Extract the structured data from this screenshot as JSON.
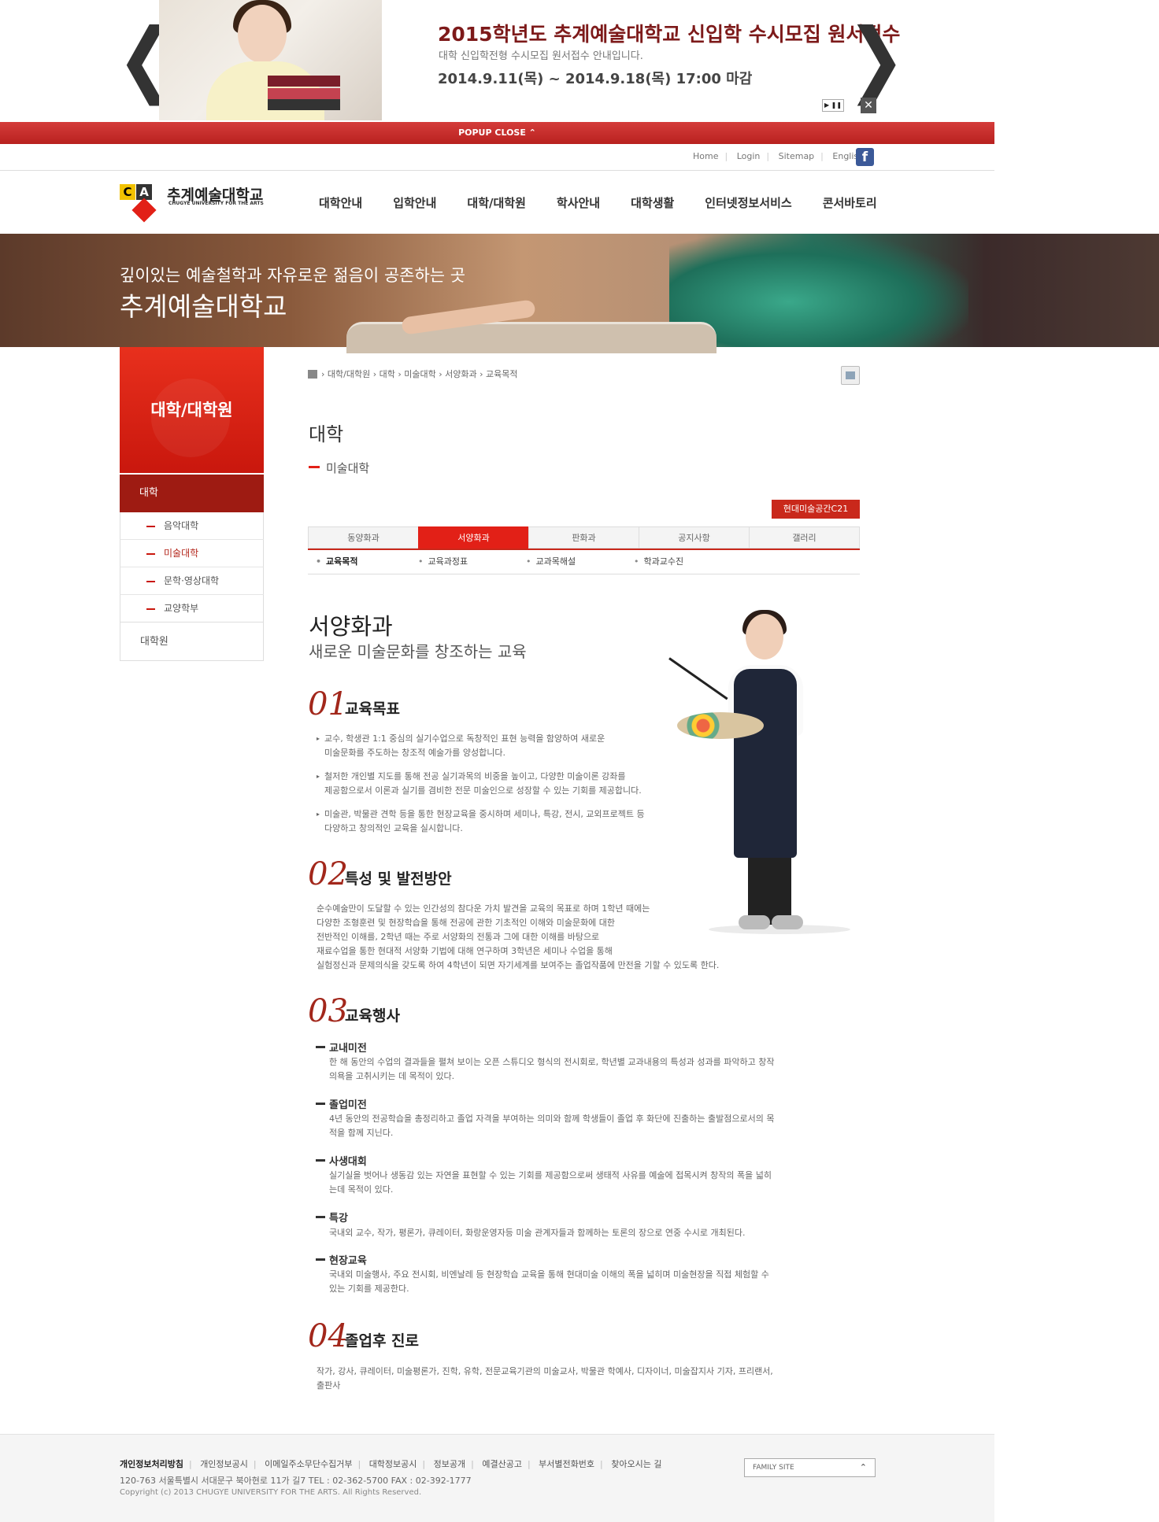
{
  "popup": {
    "title": "2015학년도 추계예술대학교 신입학 수시모집 원서접수",
    "subtitle": "대학 신입학전형 수시모집 원서접수 안내입니다.",
    "date": "2014.9.11(목) ~ 2014.9.18(목) 17:00 마감",
    "prev_arrow": "❮",
    "next_arrow": "❯",
    "play_pause": "▶ ❚❚",
    "close_x": "✕",
    "close_label": "POPUP CLOSE ⌃"
  },
  "utility": {
    "links": [
      "Home",
      "Login",
      "Sitemap",
      "English"
    ],
    "facebook": "f"
  },
  "logo": {
    "mark_c": "C",
    "mark_a": "A",
    "name": "추계예술대학교",
    "eng": "CHUGYE UNIVERSITY FOR THE ARTS"
  },
  "gnb": [
    "대학안내",
    "입학안내",
    "대학/대학원",
    "학사안내",
    "대학생활",
    "인터넷정보서비스",
    "콘서바토리"
  ],
  "banner": {
    "subtitle": "깊이있는 예술철학과 자유로운 젊음이 공존하는 곳",
    "title": "추계예술대학교"
  },
  "sidebar": {
    "header": "대학/대학원",
    "current": "대학",
    "items": [
      "음악대학",
      "미술대학",
      "문학·영상대학",
      "교양학부"
    ],
    "grad": "대학원"
  },
  "breadcrumb": "›  대학/대학원  ›  대학  ›  미술대학  ›  서양화과  ›  교육목적",
  "page": {
    "title": "대학",
    "subtitle": "미술대학",
    "ext_button": "현대미술공간C21"
  },
  "tabs": [
    "동양화과",
    "서양화과",
    "판화과",
    "공지사항",
    "갤러리"
  ],
  "active_tab": "서양화과",
  "subtabs": [
    "교육목적",
    "교육과정표",
    "교과목해설",
    "학과교수진"
  ],
  "main": {
    "heading": "서양화과",
    "heading_sub": "새로운 미술문화를 창조하는 교육",
    "s1": {
      "num": "01",
      "title": "교육목표",
      "bullets": [
        [
          "교수, 학생관 1:1 중심의 실기수업으로 독창적인 표현 능력을 함양하여 새로운",
          "미술문화를 주도하는 창조적 예술가를 양성합니다."
        ],
        [
          "철저한 개인별 지도를 통해 전공 실기과목의 비중을 높이고, 다양한 미술이론 강좌를",
          "제공함으로서 이론과 실기를 겸비한 전문 미술인으로 성장할 수 있는 기회를 제공합니다."
        ],
        [
          "미술관, 박물관 견학 등을 통한 현장교육을 중시하며 세미나, 특강, 전시, 교외프로젝트 등",
          "다양하고 창의적인 교육을 실시합니다."
        ]
      ]
    },
    "s2": {
      "num": "02",
      "title": "특성 및 발전방안",
      "lines": [
        "순수예술만이 도달할 수 있는 인간성의 참다운 가치 발견을 교육의 목표로 하며 1학년 때에는",
        "다양한 조형훈련 및 현장학습을 통해 전공에 관한 기초적인 이해와 미술문화에 대한",
        "전반적인 이해를, 2학년 때는 주로 서양화의 전통과 그에 대한 이해를 바탕으로",
        "재료수업을 통한 현대적 서양화 기법에 대해 연구하며 3학년은 세미나 수업을 통해",
        "실험정신과 문제의식을 갖도록 하여 4학년이 되면 자기세계를 보여주는 졸업작품에 만전을 기할 수 있도록 한다."
      ]
    },
    "s3": {
      "num": "03",
      "title": "교육행사",
      "events": [
        {
          "title": "교내미전",
          "lines": [
            "한 해 동안의 수업의 결과들을 펼쳐 보이는 오픈 스튜디오 형식의 전시회로, 학년별 교과내용의 특성과 성과를 파악하고 창작",
            "의욕을 고취시키는 데 목적이 있다."
          ]
        },
        {
          "title": "졸업미전",
          "lines": [
            "4년 동안의 전공학습을 총정리하고 졸업 자격을 부여하는 의미와 함께 학생들이 졸업 후 화단에 진출하는 출발점으로서의 목",
            "적을 함께 지닌다."
          ]
        },
        {
          "title": "사생대회",
          "lines": [
            "실기실을 벗어나 생동감 있는 자연을 표현할 수 있는 기회를 제공함으로써 생태적 사유를 예술에 접목시켜 창작의 폭을 넓히",
            "는데 목적이 있다."
          ]
        },
        {
          "title": "특강",
          "lines": [
            "국내외 교수, 작가, 평론가, 큐레이터, 화랑운영자등 미술 관계자들과 함께하는 토론의 장으로 연중 수시로 개최된다."
          ]
        },
        {
          "title": "현장교육",
          "lines": [
            "국내외 미술행사, 주요 전시회, 비엔날레 등 현장학습 교육을 통해 현대미술 이해의 폭을 넓히며 미술현장을 직접 체험할 수",
            "있는 기회를 제공한다."
          ]
        }
      ]
    },
    "s4": {
      "num": "04",
      "title": "졸업후 진로",
      "lines": [
        "작가, 강사, 큐레이터, 미술평론가, 진학, 유학, 전문교육기관의 미술교사, 박물관 학예사, 디자이너, 미술잡지사 기자, 프리랜서,",
        "출판사"
      ]
    }
  },
  "footer": {
    "links": [
      "개인정보처리방침",
      "개인정보공시",
      "이메일주소무단수집거부",
      "대학정보공시",
      "정보공개",
      "예결산공고",
      "부서별전화번호",
      "찾아오시는 길"
    ],
    "address": "120-763 서울특별시 서대문구 북아현로 11가 길7 TEL : 02-362-5700 FAX : 02-392-1777",
    "copyright": "Copyright (c) 2013 CHUGYE UNIVERSITY FOR THE ARTS. All Rights Reserved.",
    "family_site": "FAMILY SITE",
    "family_chev": "⌃"
  },
  "colors": {
    "accent": "#e22017",
    "dark_red": "#9e1b12",
    "section_num": "#a2271b"
  }
}
